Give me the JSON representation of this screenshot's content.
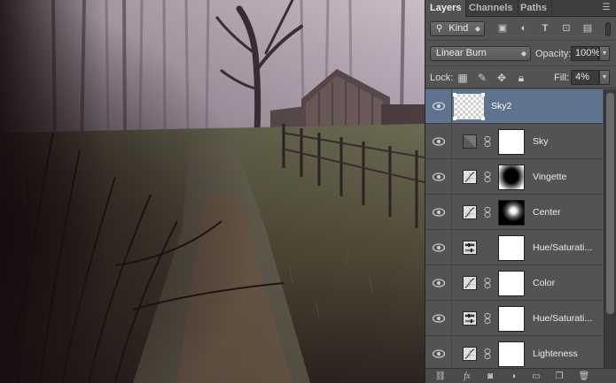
{
  "panel": {
    "tabs": [
      {
        "label": "Layers",
        "active": true
      },
      {
        "label": "Channels",
        "active": false
      },
      {
        "label": "Paths",
        "active": false
      }
    ],
    "filter": {
      "kind_label": "Kind",
      "icons": [
        "image-filter-icon",
        "adjustment-filter-icon",
        "type-filter-icon",
        "shape-filter-icon",
        "smart-object-filter-icon"
      ]
    },
    "blend": {
      "mode": "Linear Burn",
      "opacity_label": "Opacity:",
      "opacity_value": "100%"
    },
    "lock": {
      "label": "Lock:",
      "fill_label": "Fill:",
      "fill_value": "4%"
    },
    "layers": [
      {
        "name": "Sky2",
        "type": "pixel",
        "selected": true
      },
      {
        "name": "Sky",
        "type": "gradient",
        "selected": false
      },
      {
        "name": "Vingette",
        "type": "curves",
        "selected": false
      },
      {
        "name": "Center",
        "type": "curves",
        "selected": false
      },
      {
        "name": "Hue/Saturati...",
        "type": "hue",
        "selected": false
      },
      {
        "name": "Color",
        "type": "curves",
        "selected": false
      },
      {
        "name": "Hue/Saturati...",
        "type": "hue",
        "selected": false
      },
      {
        "name": "Lighteness",
        "type": "curves",
        "selected": false
      }
    ],
    "colors": {
      "panel_bg": "#535353",
      "selected_row": "#5e738e"
    }
  }
}
